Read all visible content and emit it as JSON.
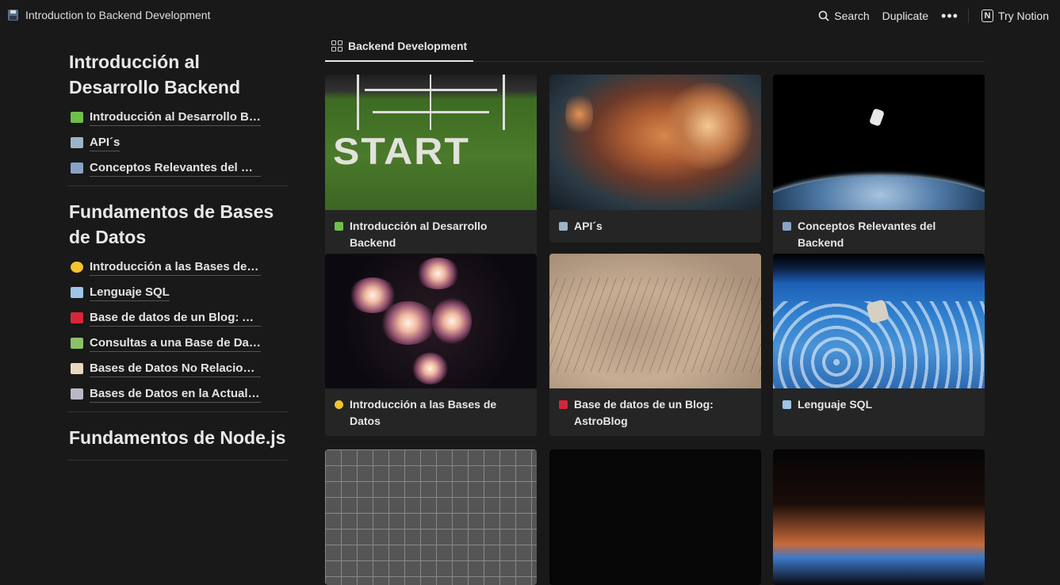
{
  "topbar": {
    "page_title": "Introduction to Backend Development",
    "search_label": "Search",
    "duplicate_label": "Duplicate",
    "more_label": "•••",
    "try_notion_label": "Try Notion"
  },
  "sidebar": {
    "sections": [
      {
        "heading": "Introducción al Desarrollo Backend",
        "items": [
          {
            "label": "Introducción al Desarrollo Backend",
            "emoji_color": "#6fbf4a"
          },
          {
            "label": "API´s",
            "emoji_color": "#9bb4c8"
          },
          {
            "label": "Conceptos Relevantes del Backend",
            "emoji_color": "#8aa2c6"
          }
        ]
      },
      {
        "heading": "Fundamentos de Bases de Datos",
        "items": [
          {
            "label": "Introducción a las Bases de Datos",
            "emoji_color": "#f2c230"
          },
          {
            "label": "Lenguaje SQL",
            "emoji_color": "#9fc4e6"
          },
          {
            "label": "Base de datos de un Blog: AstroBlog",
            "emoji_color": "#d6263a"
          },
          {
            "label": "Consultas a una Base de Datos",
            "emoji_color": "#8cc06a"
          },
          {
            "label": "Bases de Datos No Relacionales",
            "emoji_color": "#e8d8c0"
          },
          {
            "label": "Bases de Datos en la Actualidad",
            "emoji_color": "#b8b8c8"
          }
        ]
      },
      {
        "heading": "Fundamentos de Node.js",
        "items": []
      }
    ]
  },
  "view": {
    "tab_label": "Backend Development"
  },
  "cards": [
    {
      "title": "Introducción al Desarrollo Backend",
      "emoji_color": "#6fbf4a",
      "image": "start-field"
    },
    {
      "title": "API´s",
      "emoji_color": "#9bb4c8",
      "image": "nebula"
    },
    {
      "title": "Conceptos Relevantes del Backend",
      "emoji_color": "#8aa2c6",
      "image": "astronaut-earth"
    },
    {
      "title": "Introducción a las Bases de Datos",
      "emoji_color": "#f2c230",
      "image": "galaxies"
    },
    {
      "title": "Base de datos de un Blog: AstroBlog",
      "emoji_color": "#d6263a",
      "image": "desert-aerial"
    },
    {
      "title": "Lenguaje SQL",
      "emoji_color": "#9fc4e6",
      "image": "astronaut-over-earth"
    },
    {
      "title": "",
      "image": "grid-photo"
    },
    {
      "title": "",
      "image": "dark-photo"
    },
    {
      "title": "",
      "image": "earth-sunrise"
    }
  ]
}
